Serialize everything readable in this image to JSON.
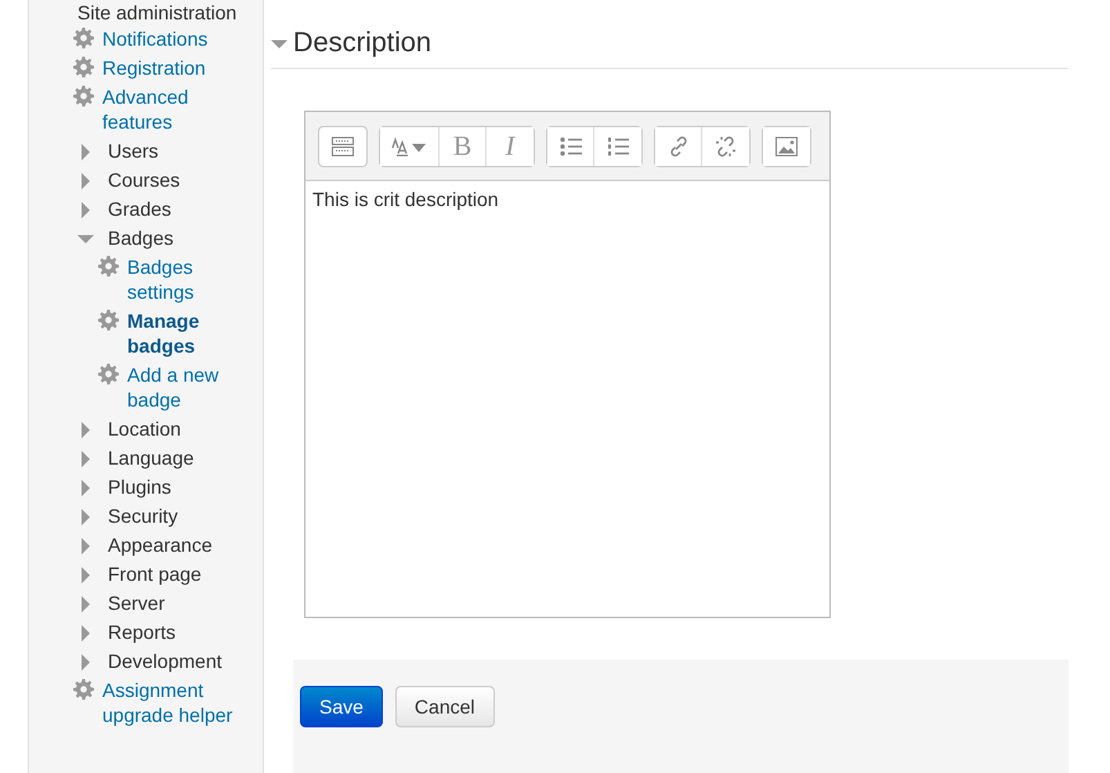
{
  "sidebar": {
    "root": {
      "label": "Site administration",
      "children": [
        {
          "kind": "page",
          "label": "Notifications",
          "selected": false
        },
        {
          "kind": "page",
          "label": "Registration",
          "selected": false
        },
        {
          "kind": "page",
          "label": "Advanced features",
          "selected": false
        },
        {
          "kind": "category",
          "label": "Users",
          "expanded": false
        },
        {
          "kind": "category",
          "label": "Courses",
          "expanded": false
        },
        {
          "kind": "category",
          "label": "Grades",
          "expanded": false
        },
        {
          "kind": "category",
          "label": "Badges",
          "expanded": true,
          "children": [
            {
              "kind": "page",
              "label": "Badges settings",
              "selected": false
            },
            {
              "kind": "page",
              "label": "Manage badges",
              "selected": true
            },
            {
              "kind": "page",
              "label": "Add a new badge",
              "selected": false
            }
          ]
        },
        {
          "kind": "category",
          "label": "Location",
          "expanded": false
        },
        {
          "kind": "category",
          "label": "Language",
          "expanded": false
        },
        {
          "kind": "category",
          "label": "Plugins",
          "expanded": false
        },
        {
          "kind": "category",
          "label": "Security",
          "expanded": false
        },
        {
          "kind": "category",
          "label": "Appearance",
          "expanded": false
        },
        {
          "kind": "category",
          "label": "Front page",
          "expanded": false
        },
        {
          "kind": "category",
          "label": "Server",
          "expanded": false
        },
        {
          "kind": "category",
          "label": "Reports",
          "expanded": false
        },
        {
          "kind": "category",
          "label": "Development",
          "expanded": false
        },
        {
          "kind": "page",
          "label": "Assignment upgrade helper",
          "selected": false
        }
      ]
    }
  },
  "section": {
    "title": "Description",
    "expanded": true
  },
  "editor": {
    "toolbar": [
      [
        {
          "kind": "collapse"
        }
      ],
      [
        {
          "kind": "fontstyle"
        },
        {
          "kind": "text",
          "label": "B"
        },
        {
          "kind": "text",
          "label": "I",
          "italic": true
        }
      ],
      [
        {
          "kind": "bullets"
        },
        {
          "kind": "numbers"
        }
      ],
      [
        {
          "kind": "link"
        },
        {
          "kind": "unlink"
        }
      ],
      [
        {
          "kind": "image"
        }
      ]
    ],
    "value": "This is crit description"
  },
  "buttons": [
    {
      "label": "Save",
      "primary": true
    },
    {
      "label": "Cancel",
      "primary": false
    }
  ]
}
